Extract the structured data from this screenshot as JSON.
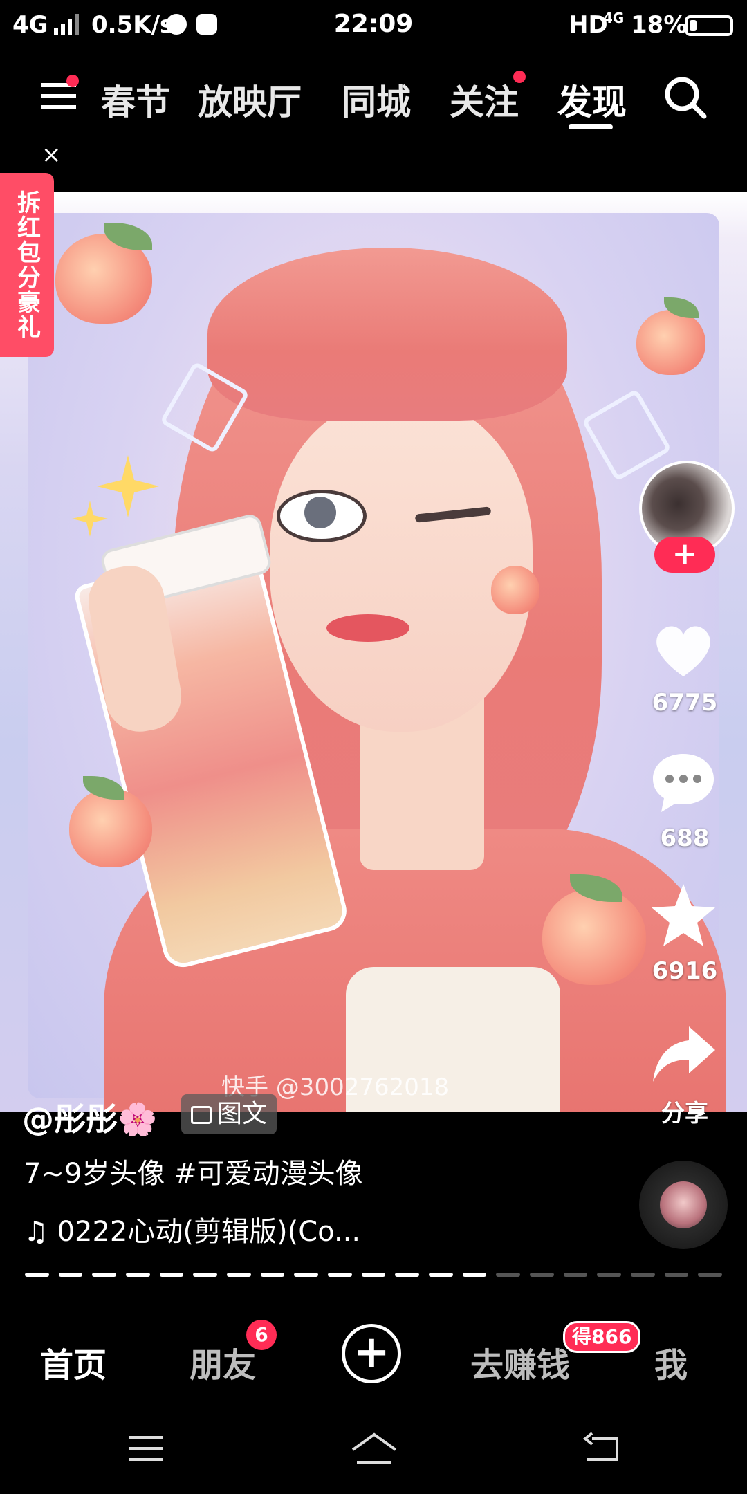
{
  "status_bar": {
    "network": "4G",
    "speed": "0.5K/s",
    "time": "22:09",
    "hd": "HD",
    "hd_network": "4G",
    "battery_percent": "18%",
    "battery_level": 0.18
  },
  "top_nav": {
    "menu_icon": "hamburger-icon",
    "tabs": [
      {
        "label": "春节"
      },
      {
        "label": "放映厅"
      },
      {
        "label": "同城"
      },
      {
        "label": "关注"
      },
      {
        "label": "发现"
      }
    ],
    "active_tab": "发现",
    "search_icon": "search-icon"
  },
  "banner": {
    "label": "拆红包分豪礼",
    "close_symbol": "×"
  },
  "post": {
    "watermark": "快手 @3002762018",
    "author": "@彤彤🌸",
    "type_label": "图文",
    "description": "7~9岁头像 #可爱动漫头像",
    "music": "0222心动(剪辑版)(Co...",
    "progress_total": 21,
    "progress_current": 14
  },
  "actions": {
    "follow_symbol": "+",
    "like_count": "6775",
    "comment_count": "688",
    "favorite_count": "6916",
    "share_label": "分享"
  },
  "bottom_nav": {
    "home": "首页",
    "friends": "朋友",
    "friends_badge": "6",
    "add_symbol": "+",
    "earn": "去赚钱",
    "earn_badge": "得866",
    "me": "我"
  },
  "colors": {
    "accent": "#ff2c55",
    "background": "#000000"
  }
}
